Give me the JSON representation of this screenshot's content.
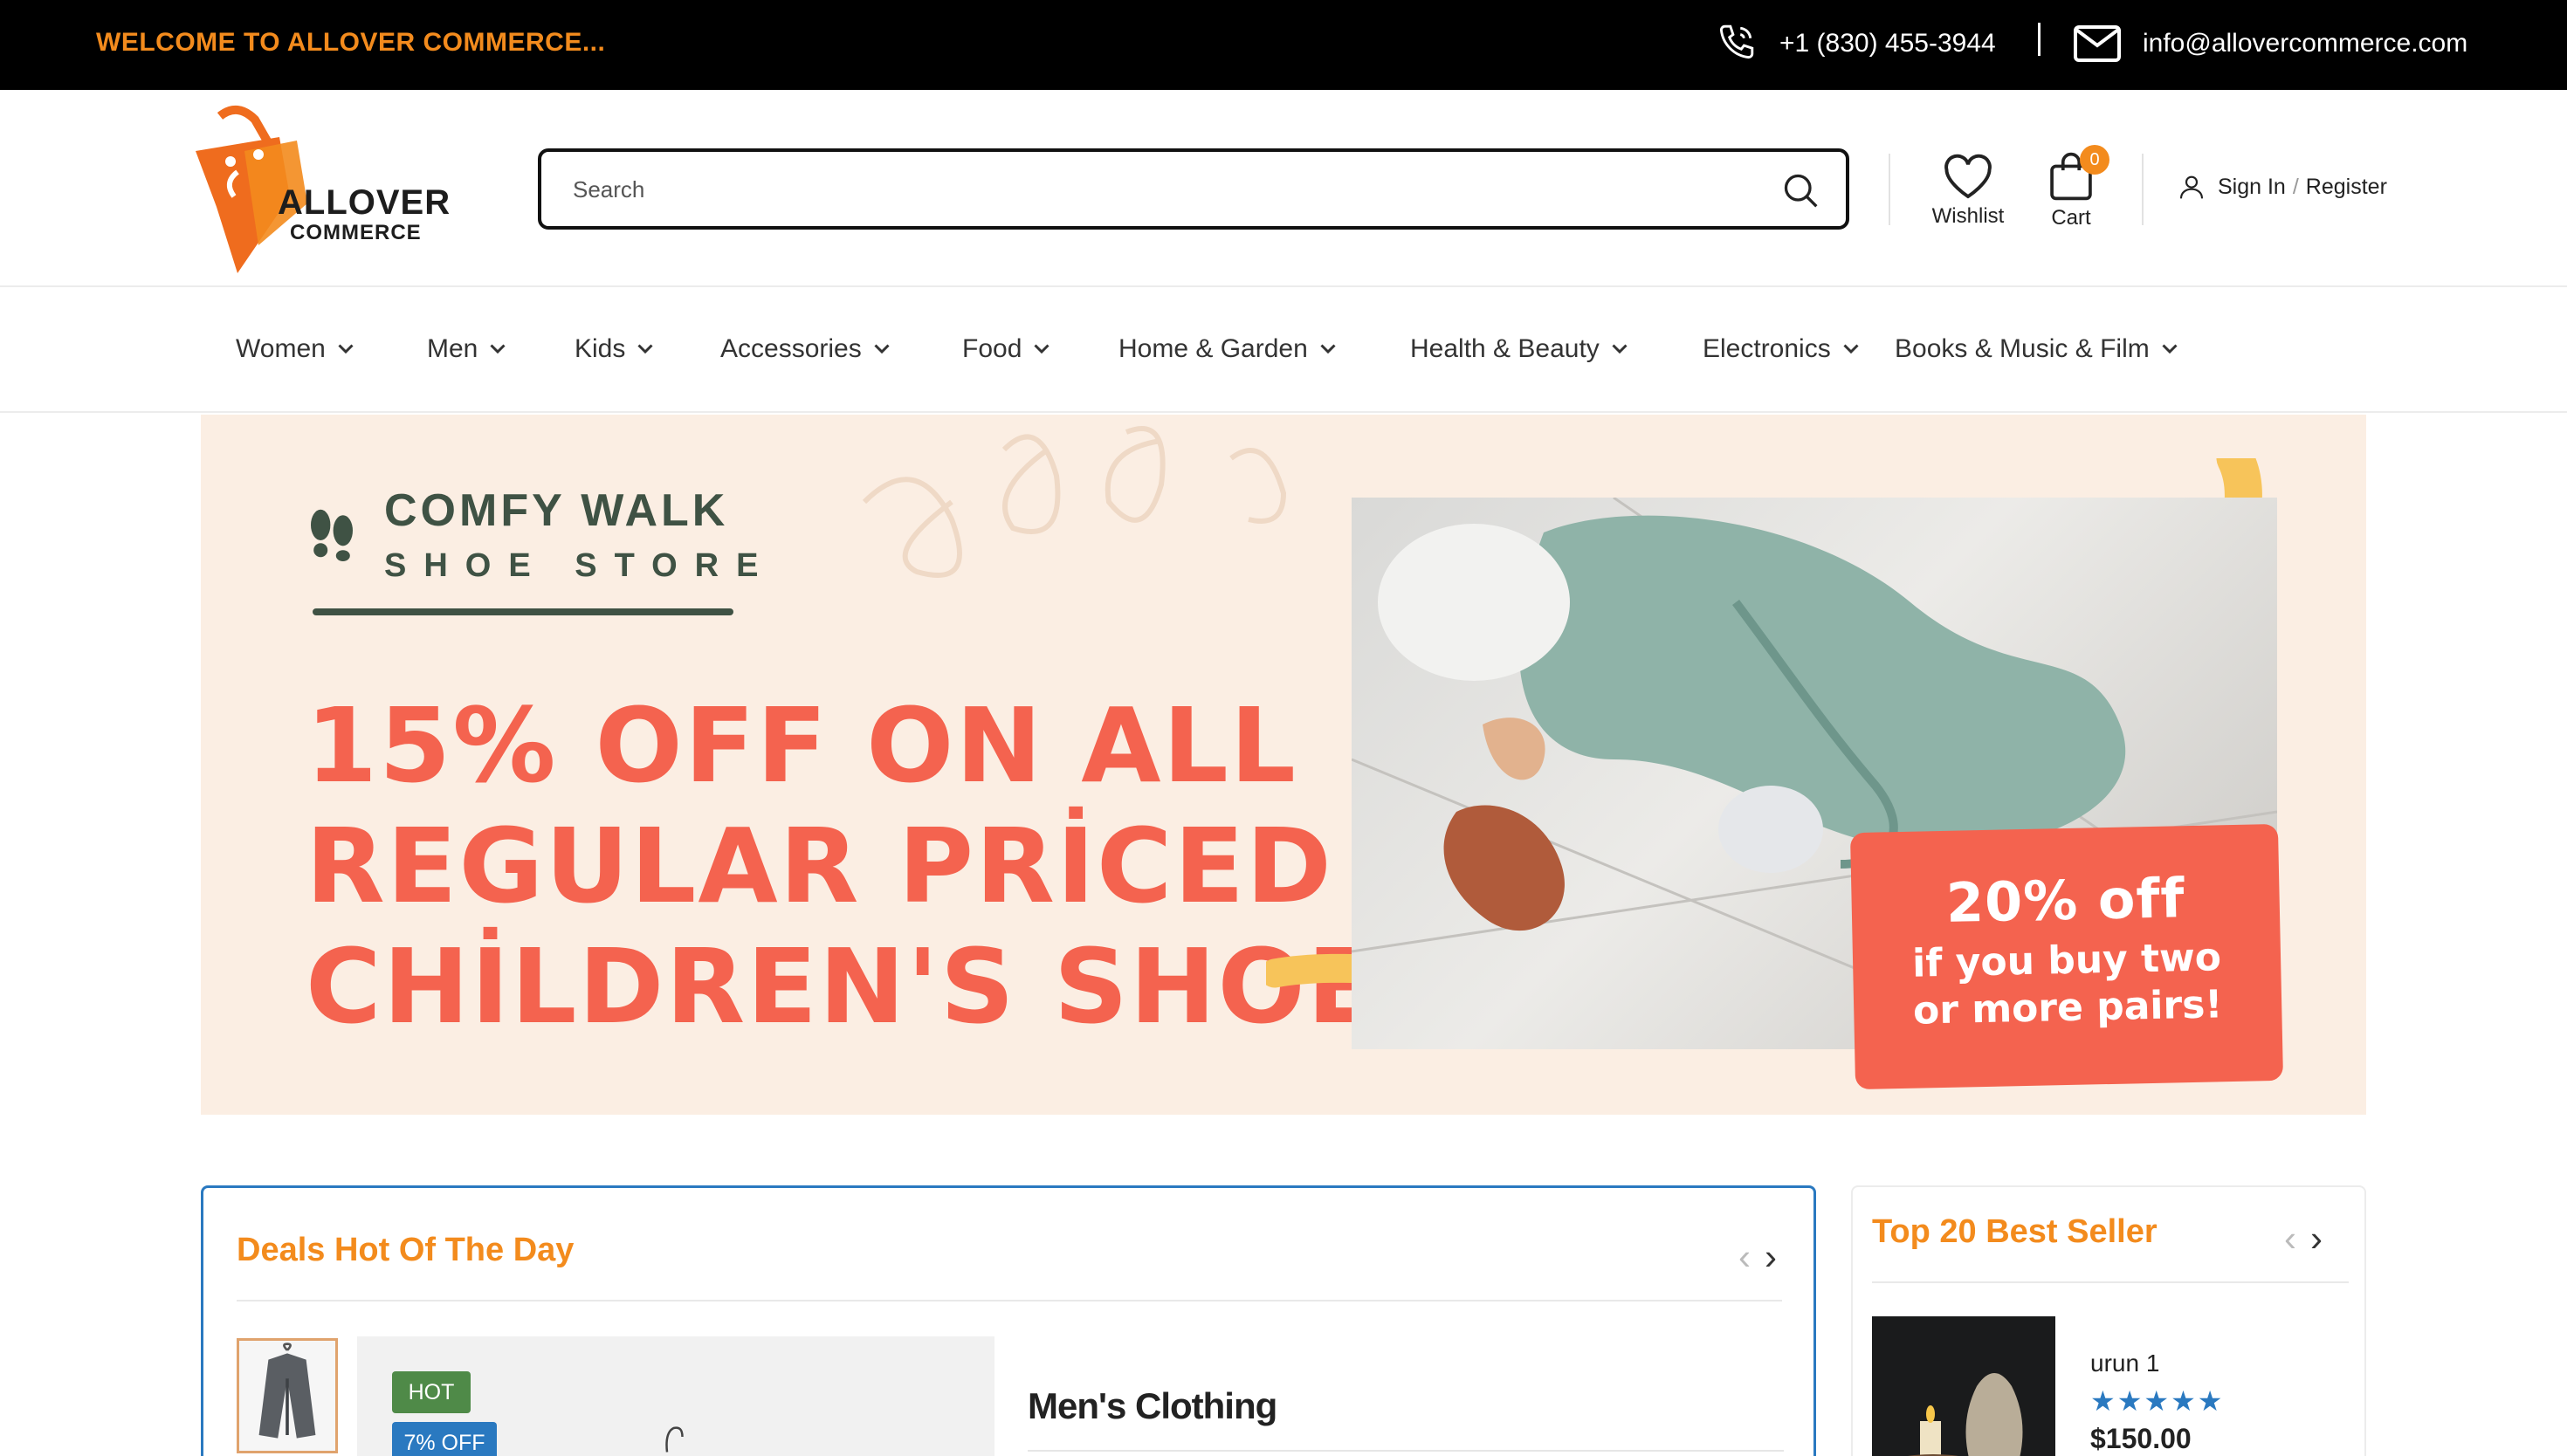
{
  "topbar": {
    "welcome": "WELCOME TO ALLOVER COMMERCE...",
    "phone": "+1 (830) 455-3944",
    "email": "info@allovercommerce.com"
  },
  "header": {
    "logo_line1": "ALLOVER",
    "logo_line2": "COMMERCE",
    "search_placeholder": "Search",
    "wishlist_label": "Wishlist",
    "cart_label": "Cart",
    "cart_count": "0",
    "sign_in": "Sign In",
    "separator": "/",
    "register": "Register"
  },
  "nav": {
    "items": [
      {
        "label": "Women"
      },
      {
        "label": "Men"
      },
      {
        "label": "Kids"
      },
      {
        "label": "Accessories"
      },
      {
        "label": "Food"
      },
      {
        "label": "Home & Garden"
      },
      {
        "label": "Health & Beauty"
      },
      {
        "label": "Electronics"
      },
      {
        "label": "Books & Music & Film"
      }
    ]
  },
  "banner": {
    "brand_title": "COMFY WALK",
    "brand_subtitle": "SHOE STORE",
    "headline_line1": "15% OFF ON ALL",
    "headline_line2": "REGULAR PRİCED",
    "headline_line3": "CHİLDREN'S SHOES",
    "promo_big": "20% off",
    "promo_line1": "if you buy two",
    "promo_line2": "or more pairs!"
  },
  "deals": {
    "title": "Deals Hot Of The Day",
    "tag_hot": "HOT",
    "tag_discount": "7% OFF",
    "product_name": "Men's Clothing"
  },
  "best_seller": {
    "title": "Top 20 Best Seller",
    "product_name": "urun 1",
    "rating": 5,
    "stars": "★★★★★",
    "price": "$150.00"
  },
  "colors": {
    "accent_orange": "#f38b1d",
    "accent_blue": "#2a79c0",
    "banner_bg": "#fbeee3",
    "banner_red": "#f4634f",
    "hot_green": "#4f8a48"
  }
}
